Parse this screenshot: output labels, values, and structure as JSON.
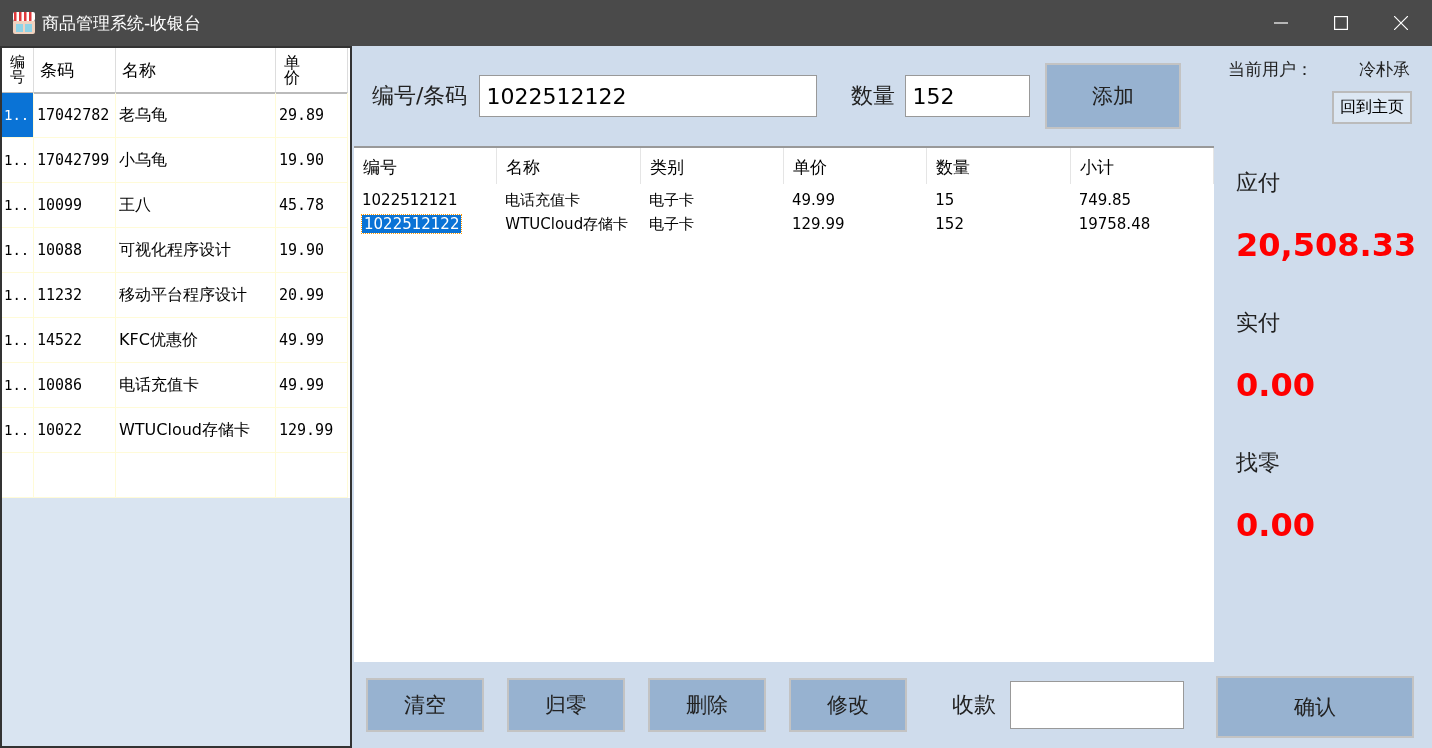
{
  "window": {
    "title": "商品管理系统-收银台"
  },
  "product_table": {
    "columns": [
      "编号",
      "条码",
      "名称",
      "单价"
    ],
    "rows": [
      {
        "cells": [
          "1..",
          "17042782",
          "老乌龟",
          "29.89"
        ],
        "selected": true
      },
      {
        "cells": [
          "1..",
          "17042799",
          "小乌龟",
          "19.90"
        ],
        "selected": false
      },
      {
        "cells": [
          "1..",
          "10099",
          "王八",
          "45.78"
        ],
        "selected": false
      },
      {
        "cells": [
          "1..",
          "10088",
          "可视化程序设计",
          "19.90"
        ],
        "selected": false
      },
      {
        "cells": [
          "1..",
          "11232",
          "移动平台程序设计",
          "20.99"
        ],
        "selected": false
      },
      {
        "cells": [
          "1..",
          "14522",
          "KFC优惠价",
          "49.99"
        ],
        "selected": false
      },
      {
        "cells": [
          "1..",
          "10086",
          "电话充值卡",
          "49.99"
        ],
        "selected": false
      },
      {
        "cells": [
          "1..",
          "10022",
          "WTUCloud存储卡",
          "129.99"
        ],
        "selected": false
      }
    ]
  },
  "entry": {
    "code_label": "编号/条码",
    "code_value": "1022512122",
    "qty_label": "数量",
    "qty_value": "152",
    "add_button": "添加"
  },
  "user": {
    "label": "当前用户：",
    "name": "冷朴承",
    "home_button": "回到主页"
  },
  "cart": {
    "columns": [
      "编号",
      "名称",
      "类别",
      "单价",
      "数量",
      "小计"
    ],
    "rows": [
      {
        "cells": [
          "1022512121",
          "电话充值卡",
          "电子卡",
          "49.99",
          "15",
          "749.85"
        ],
        "selected": false
      },
      {
        "cells": [
          "1022512122",
          "WTUCloud存储卡",
          "电子卡",
          "129.99",
          "152",
          "19758.48"
        ],
        "selected": true
      }
    ]
  },
  "summary": [
    {
      "label": "应付",
      "amount": "20,508.33"
    },
    {
      "label": "实付",
      "amount": "0.00"
    },
    {
      "label": "找零",
      "amount": "0.00"
    }
  ],
  "actions": [
    "清空",
    "归零",
    "删除",
    "修改"
  ],
  "payment": {
    "label": "收款",
    "confirm_button": "确认"
  }
}
